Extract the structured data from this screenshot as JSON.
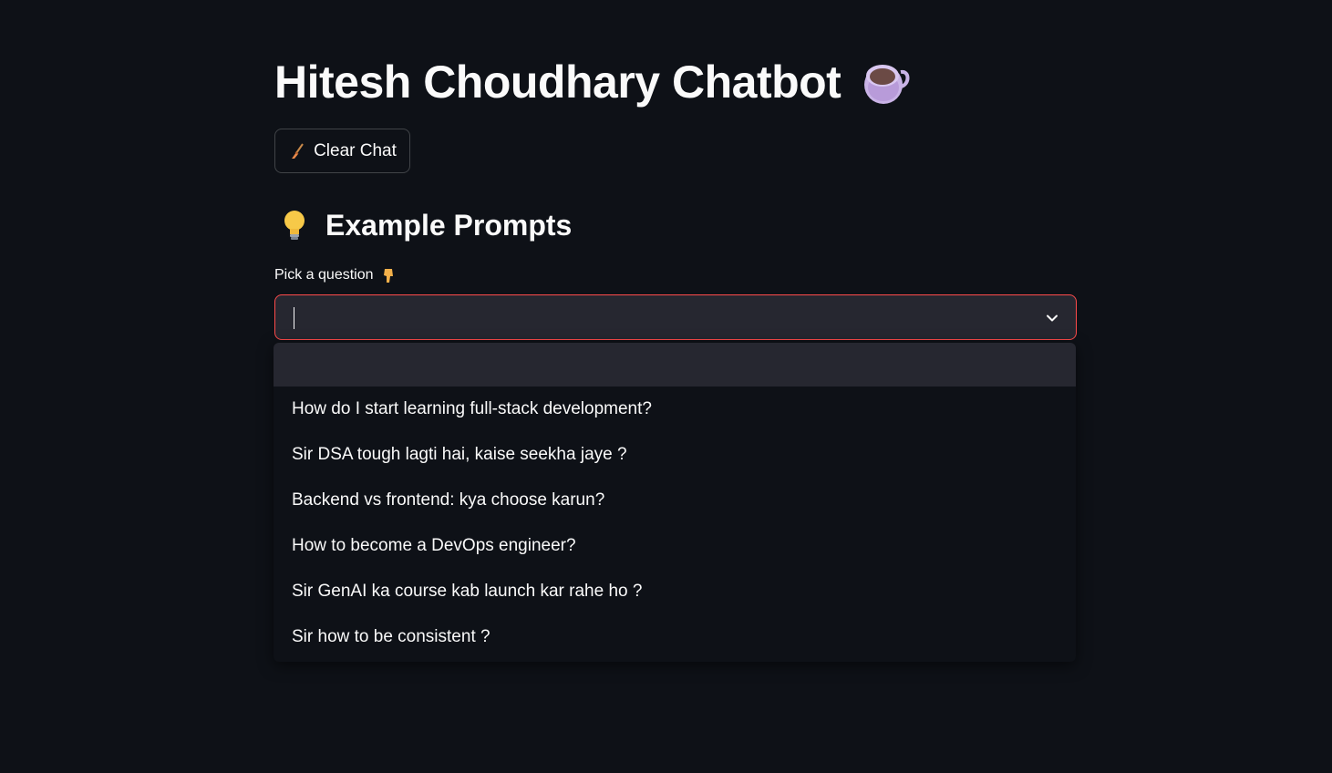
{
  "header": {
    "title": "Hitesh Choudhary Chatbot",
    "title_icon": "tea-cup-icon"
  },
  "toolbar": {
    "clear_label": "Clear Chat",
    "clear_icon": "broom-icon"
  },
  "examples": {
    "heading": "Example Prompts",
    "heading_icon": "light-bulb-icon",
    "select_label": "Pick a question",
    "select_label_icon": "pointing-down-icon",
    "selected_value": "",
    "options": [
      "How do I start learning full-stack development?",
      "Sir DSA tough lagti hai, kaise seekha jaye ?",
      "Backend vs frontend: kya choose karun?",
      "How to become a DevOps engineer?",
      "Sir GenAI ka course kab launch kar rahe ho ?",
      "Sir how to be consistent ?"
    ]
  },
  "colors": {
    "background": "#0e1117",
    "input_bg": "#262730",
    "focus_border": "#ff4b4b",
    "text": "#fafafa"
  }
}
